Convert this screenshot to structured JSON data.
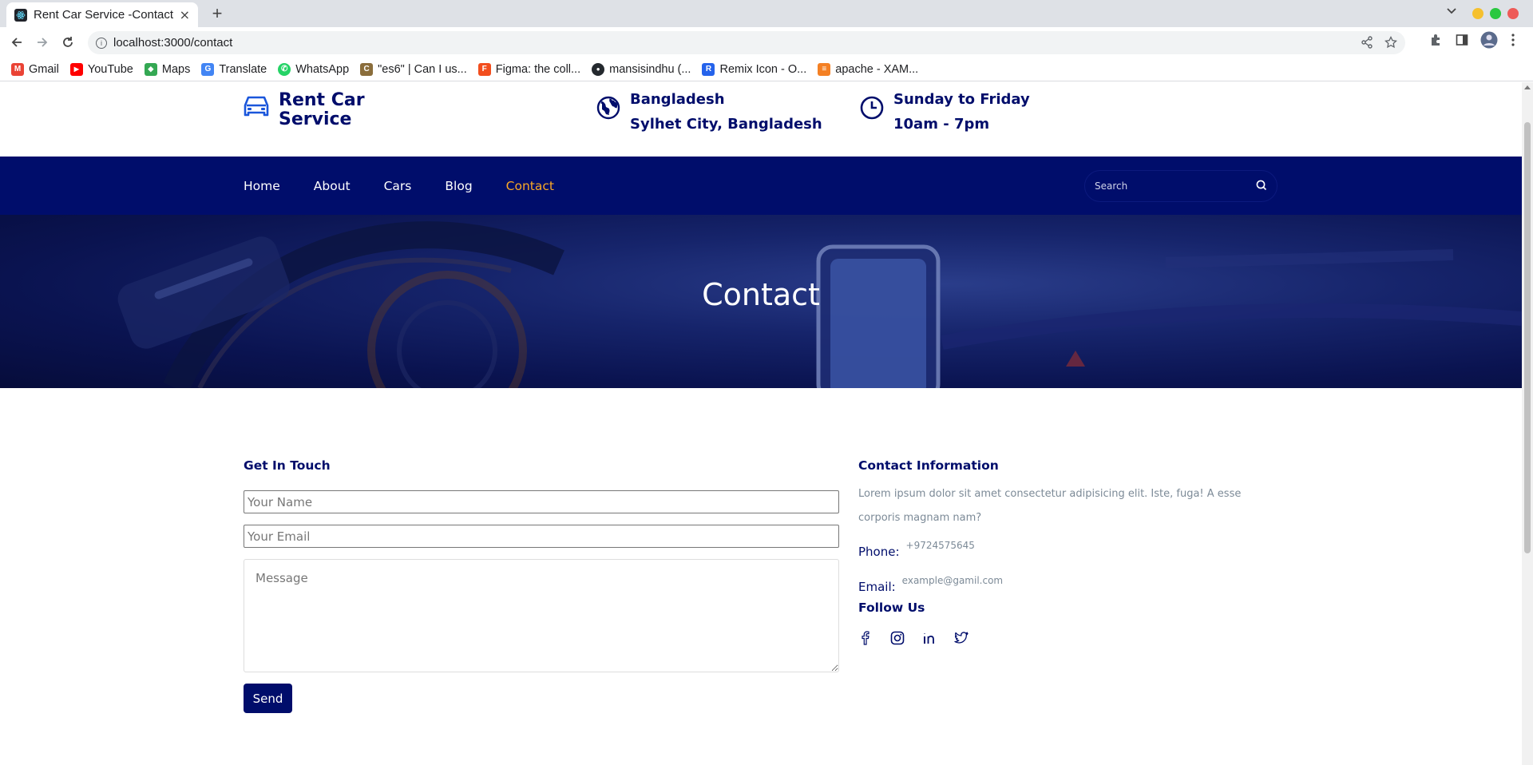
{
  "browser": {
    "tab_title": "Rent Car Service -Contact",
    "tab_close": "×",
    "new_tab": "+",
    "url": "localhost:3000/contact",
    "bookmarks": [
      {
        "label": "Gmail",
        "icon": "gmail-icon",
        "color": "#ea4335",
        "glyph": "M"
      },
      {
        "label": "YouTube",
        "icon": "youtube-icon",
        "color": "#ff0000",
        "glyph": "▶"
      },
      {
        "label": "Maps",
        "icon": "maps-icon",
        "color": "#34a853",
        "glyph": "◆"
      },
      {
        "label": "Translate",
        "icon": "translate-icon",
        "color": "#4285f4",
        "glyph": "G"
      },
      {
        "label": "WhatsApp",
        "icon": "whatsapp-icon",
        "color": "#25d366",
        "glyph": "✆"
      },
      {
        "label": "\"es6\" | Can I us...",
        "icon": "caniuse-icon",
        "color": "#8a6d3b",
        "glyph": "C"
      },
      {
        "label": "Figma: the coll...",
        "icon": "figma-icon",
        "color": "#f24e1e",
        "glyph": "F"
      },
      {
        "label": "mansisindhu (...",
        "icon": "github-icon",
        "color": "#24292e",
        "glyph": "●"
      },
      {
        "label": "Remix Icon - O...",
        "icon": "remix-icon",
        "color": "#2563eb",
        "glyph": "R"
      },
      {
        "label": "apache - XAM...",
        "icon": "stackoverflow-icon",
        "color": "#f48024",
        "glyph": "≡"
      }
    ]
  },
  "header": {
    "brand": "Rent Car Service",
    "location_title": "Bangladesh",
    "location_sub": "Sylhet City, Bangladesh",
    "hours_title": "Sunday to Friday",
    "hours_sub": "10am - 7pm"
  },
  "nav": {
    "items": [
      "Home",
      "About",
      "Cars",
      "Blog",
      "Contact"
    ],
    "active": "Contact",
    "search_placeholder": "Search"
  },
  "hero": {
    "title": "Contact"
  },
  "contact": {
    "form_title": "Get In Touch",
    "name_placeholder": "Your Name",
    "email_placeholder": "Your Email",
    "message_placeholder": "Message",
    "send_label": "Send",
    "info_title": "Contact Information",
    "info_desc": "Lorem ipsum dolor sit amet consectetur adipisicing elit. Iste, fuga! A esse corporis magnam nam?",
    "phone_label": "Phone:",
    "phone_value": "+9724575645",
    "email_label": "Email:",
    "email_value": "example@gamil.com",
    "follow_title": "Follow Us",
    "socials": [
      "facebook-icon",
      "instagram-icon",
      "linkedin-icon",
      "twitter-icon"
    ]
  },
  "colors": {
    "primary": "#000d6b",
    "accent": "#f9a826",
    "muted": "#7c8a97"
  }
}
